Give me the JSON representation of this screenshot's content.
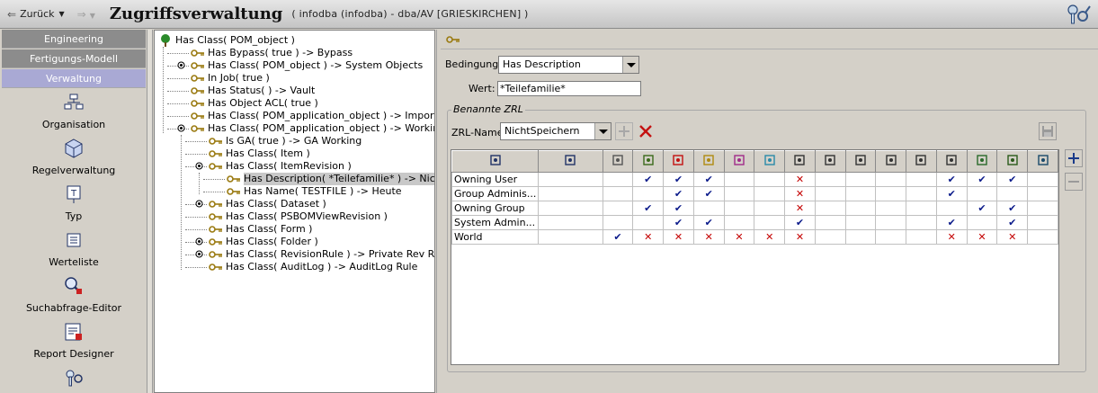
{
  "header": {
    "back_label": "Zurück",
    "title": "Zugriffsverwaltung",
    "context": "( infodba (infodba) - dba/AV  [GRIESKIRCHEN] )"
  },
  "nav": {
    "buttons": [
      {
        "label": "Engineering",
        "active": false
      },
      {
        "label": "Fertigungs-Modell",
        "active": false
      },
      {
        "label": "Verwaltung",
        "active": true
      }
    ],
    "items": [
      {
        "label": "Organisation",
        "icon": "organisation-icon"
      },
      {
        "label": "Regelverwaltung",
        "icon": "rule-cube-icon"
      },
      {
        "label": "Typ",
        "icon": "type-icon"
      },
      {
        "label": "Werteliste",
        "icon": "list-icon"
      },
      {
        "label": "Suchabfrage-Editor",
        "icon": "query-editor-icon"
      },
      {
        "label": "Report Designer",
        "icon": "report-designer-icon"
      }
    ]
  },
  "tree": {
    "rows": [
      {
        "text": "Has Class( POM_object )",
        "indent": 0,
        "icon": "tree-root-icon"
      },
      {
        "text": "Has Bypass( true ) -> Bypass",
        "indent": 1
      },
      {
        "text": "Has Class( POM_object ) -> System Objects",
        "indent": 1,
        "toggle": "collapsed"
      },
      {
        "text": "In Job( true )",
        "indent": 1
      },
      {
        "text": "Has Status(  ) -> Vault",
        "indent": 1
      },
      {
        "text": "Has Object ACL( true )",
        "indent": 1
      },
      {
        "text": "Has Class( POM_application_object ) -> Import/Export",
        "indent": 1
      },
      {
        "text": "Has Class( POM_application_object ) -> Working",
        "indent": 1,
        "toggle": "expanded"
      },
      {
        "text": "Is GA( true ) -> GA Working",
        "indent": 2
      },
      {
        "text": "Has Class( Item )",
        "indent": 2
      },
      {
        "text": "Has Class( ItemRevision )",
        "indent": 2,
        "toggle": "expanded"
      },
      {
        "text": "Has Description( *Teilefamilie* ) -> NichtSpeichern",
        "indent": 3,
        "selected": true
      },
      {
        "text": "Has Name( TESTFILE ) -> Heute",
        "indent": 3
      },
      {
        "text": "Has Class( Dataset )",
        "indent": 2,
        "toggle": "collapsed"
      },
      {
        "text": "Has Class( PSBOMViewRevision )",
        "indent": 2
      },
      {
        "text": "Has Class( Form )",
        "indent": 2
      },
      {
        "text": "Has Class( Folder )",
        "indent": 2,
        "toggle": "collapsed"
      },
      {
        "text": "Has Class( RevisionRule ) -> Private Rev Rule",
        "indent": 2,
        "toggle": "collapsed"
      },
      {
        "text": "Has Class( AuditLog ) -> AuditLog Rule",
        "indent": 2
      }
    ]
  },
  "rule": {
    "condition_label": "Bedingung:",
    "condition_value": "Has Description",
    "value_label": "Wert:",
    "value_value": "*Teilefamilie*",
    "group_title": "Benannte ZRL",
    "zrl_label": "ZRL-Name:",
    "zrl_value": "NichtSpeichern"
  },
  "acl": {
    "columns": [
      "accessor-type-icon",
      "accessor-icon",
      "read-icon",
      "write-icon",
      "delete-icon",
      "change-ownership-icon",
      "promote-icon",
      "demote-icon",
      "copy-icon",
      "export-icon",
      "import-icon",
      "transfer-out-icon",
      "transfer-in-icon",
      "change-icon",
      "publish-icon",
      "subscribe-icon",
      "remote-checkout-icon"
    ],
    "rows": [
      {
        "name": "Owning User",
        "cells": [
          "",
          "",
          "check",
          "check",
          "check",
          "",
          "",
          "cross",
          "",
          "",
          "",
          "",
          "check",
          "check",
          "check",
          ""
        ]
      },
      {
        "name": "Group Adminis...",
        "cells": [
          "",
          "",
          "",
          "check",
          "check",
          "",
          "",
          "cross",
          "",
          "",
          "",
          "",
          "check",
          "",
          "",
          ""
        ]
      },
      {
        "name": "Owning Group",
        "cells": [
          "",
          "",
          "check",
          "check",
          "",
          "",
          "",
          "cross",
          "",
          "",
          "",
          "",
          "",
          "check",
          "check",
          ""
        ]
      },
      {
        "name": "System Admin...",
        "cells": [
          "",
          "",
          "",
          "check",
          "check",
          "",
          "",
          "check",
          "",
          "",
          "",
          "",
          "check",
          "",
          "check",
          ""
        ]
      },
      {
        "name": "World",
        "cells": [
          "",
          "check",
          "cross",
          "cross",
          "cross",
          "cross",
          "cross",
          "cross",
          "",
          "",
          "",
          "",
          "cross",
          "cross",
          "cross",
          ""
        ]
      }
    ]
  }
}
